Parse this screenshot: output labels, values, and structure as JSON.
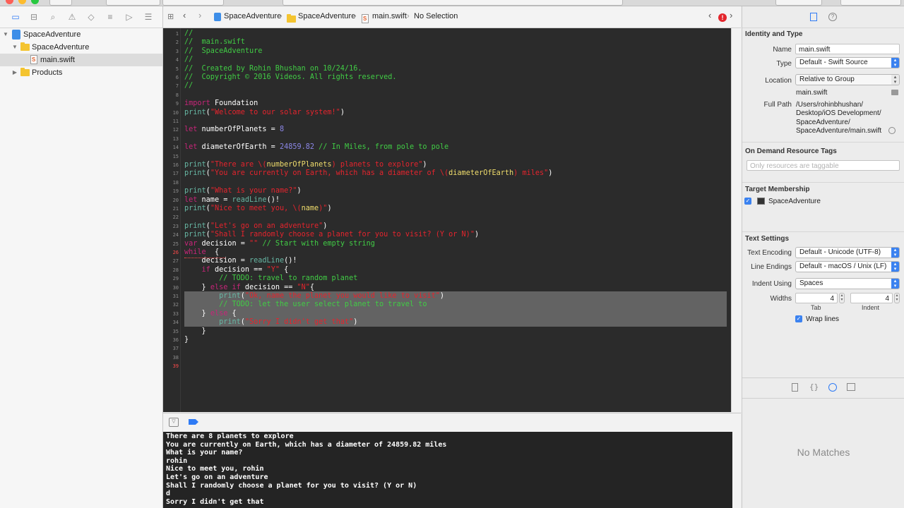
{
  "navigator": {
    "items": [
      {
        "label": "SpaceAdventure"
      },
      {
        "label": "SpaceAdventure"
      },
      {
        "label": "main.swift"
      },
      {
        "label": "Products"
      }
    ]
  },
  "jumpbar": {
    "project": "SpaceAdventure",
    "group": "SpaceAdventure",
    "file": "main.swift",
    "selection": "No Selection",
    "error_badge": "!"
  },
  "editor": {
    "line_numbers": [
      "1",
      "2",
      "3",
      "4",
      "5",
      "6",
      "7",
      "8",
      "9",
      "10",
      "11",
      "12",
      "13",
      "14",
      "15",
      "16",
      "17",
      "18",
      "19",
      "20",
      "21",
      "22",
      "23",
      "24",
      "25",
      "26",
      "27",
      "28",
      "29",
      "30",
      "31",
      "32",
      "33",
      "34",
      "35",
      "36",
      "37",
      "38",
      "39"
    ],
    "lines": [
      "//",
      "//  main.swift",
      "//  SpaceAdventure",
      "//",
      "//  Created by Rohin Bhushan on 10/24/16.",
      "//  Copyright © 2016 Videos. All rights reserved.",
      "//",
      "",
      "import Foundation",
      "print(\"Welcome to our solar system!\")",
      "",
      "let numberOfPlanets = 8",
      "",
      "let diameterOfEarth = 24859.82 // In Miles, from pole to pole",
      "",
      "print(\"There are \\(numberOfPlanets) planets to explore\")",
      "print(\"You are currently on Earth, which has a diameter of \\(diameterOfEarth) miles\")",
      "",
      "print(\"What is your name?\")",
      "let name = readLine()!",
      "print(\"Nice to meet you, \\(name)\")",
      "",
      "print(\"Let's go on an adventure\")",
      "print(\"Shall I randomly choose a planet for you to visit? (Y or N)\")",
      "var decision = \"\" // Start with empty string",
      "while  {",
      "    decision = readLine()!",
      "    if decision == \"Y\" {",
      "        // TODO: travel to random planet",
      "    } else if decision == \"N\"{",
      "        print(\"Ok, name the planet you would like to visit\")",
      "        // TODO: let the user select planet to travel to",
      "    } else {",
      "        print(\"Sorry I didn't get that\")",
      "    }",
      "}",
      "",
      "",
      ""
    ]
  },
  "console": {
    "lines": [
      "There are 8 planets to explore",
      "You are currently on Earth, which has a diameter of 24859.82 miles",
      "What is your name?",
      "rohin",
      "Nice to meet you, rohin",
      "Let's go on an adventure",
      "Shall I randomly choose a planet for you to visit? (Y or N)",
      "d",
      "Sorry I didn't get that"
    ]
  },
  "inspector": {
    "identity_header": "Identity and Type",
    "name_label": "Name",
    "name_value": "main.swift",
    "type_label": "Type",
    "type_value": "Default - Swift Source",
    "location_label": "Location",
    "location_value": "Relative to Group",
    "location_file": "main.swift",
    "fullpath_label": "Full Path",
    "fullpath_lines": [
      "/Users/rohinbhushan/",
      "Desktop/iOS Development/",
      "SpaceAdventure/",
      "SpaceAdventure/main.swift"
    ],
    "odr_header": "On Demand Resource Tags",
    "odr_placeholder": "Only resources are taggable",
    "target_header": "Target Membership",
    "target_name": "SpaceAdventure",
    "text_header": "Text Settings",
    "encoding_label": "Text Encoding",
    "encoding_value": "Default - Unicode (UTF-8)",
    "endings_label": "Line Endings",
    "endings_value": "Default - macOS / Unix (LF)",
    "indent_label": "Indent Using",
    "indent_value": "Spaces",
    "widths_label": "Widths",
    "tab_value": "4",
    "indent_width_value": "4",
    "tab_label": "Tab",
    "indent_sub_label": "Indent",
    "wrap_label": "Wrap lines",
    "no_matches": "No Matches"
  }
}
